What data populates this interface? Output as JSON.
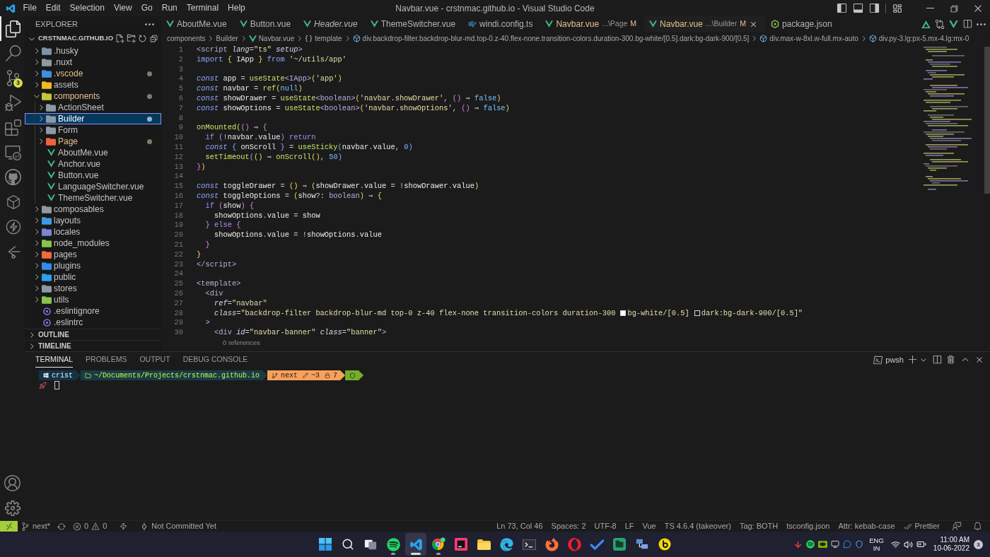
{
  "title_bar": {
    "menu": [
      "File",
      "Edit",
      "Selection",
      "View",
      "Go",
      "Run",
      "Terminal",
      "Help"
    ],
    "title": "Navbar.vue - crstnmac.github.io - Visual Studio Code"
  },
  "activity_bar": {
    "items": [
      {
        "kind": "explorer",
        "selected": true
      },
      {
        "kind": "search",
        "selected": false
      },
      {
        "kind": "source_control",
        "selected": false,
        "badge": "3"
      },
      {
        "kind": "run_debug",
        "selected": false
      },
      {
        "kind": "extensions",
        "selected": false
      },
      {
        "kind": "remote_explorer",
        "selected": false
      },
      {
        "kind": "github",
        "selected": false
      },
      {
        "kind": "cube",
        "selected": false
      },
      {
        "kind": "bolt",
        "selected": false
      },
      {
        "kind": "timeline",
        "selected": false
      }
    ],
    "bottom_items": [
      {
        "kind": "account"
      },
      {
        "kind": "settings"
      }
    ]
  },
  "sidebar": {
    "title": "EXPLORER",
    "workspace": {
      "name": "CRSTNMAC.GITHUB.IO",
      "expanded": true
    },
    "tree": [
      {
        "label": ".husky",
        "kind": "folder",
        "color": "#7d93a8",
        "expanded": false,
        "selected": false,
        "modified": false
      },
      {
        "label": ".nuxt",
        "kind": "folder",
        "color": "#8d9aa3",
        "expanded": false,
        "selected": false,
        "modified": false
      },
      {
        "label": ".vscode",
        "kind": "folder",
        "color": "#3f8fe0",
        "expanded": false,
        "selected": false,
        "modified": true
      },
      {
        "label": "assets",
        "kind": "folder",
        "color": "#f2b824",
        "expanded": false,
        "selected": false,
        "modified": false
      },
      {
        "label": "components",
        "kind": "folder",
        "color": "#c2c73a",
        "expanded": true,
        "selected": false,
        "modified": true,
        "children": [
          {
            "label": "ActionSheet",
            "kind": "folder",
            "color": "#8d9aa3",
            "expanded": false,
            "selected": false,
            "modified": false
          },
          {
            "label": "Builder",
            "kind": "folder",
            "color": "#8d9aa3",
            "expanded": false,
            "selected": true,
            "modified": true
          },
          {
            "label": "Form",
            "kind": "folder",
            "color": "#8d9aa3",
            "expanded": false,
            "selected": false,
            "modified": false
          },
          {
            "label": "Page",
            "kind": "folder",
            "color": "#f0623e",
            "expanded": false,
            "selected": false,
            "modified": true
          },
          {
            "label": "AboutMe.vue",
            "kind": "vue",
            "selected": false,
            "modified": false
          },
          {
            "label": "Anchor.vue",
            "kind": "vue",
            "selected": false,
            "modified": false
          },
          {
            "label": "Button.vue",
            "kind": "vue",
            "selected": false,
            "modified": false
          },
          {
            "label": "LanguageSwitcher.vue",
            "kind": "vue",
            "selected": false,
            "modified": false
          },
          {
            "label": "ThemeSwitcher.vue",
            "kind": "vue",
            "selected": false,
            "modified": false
          }
        ]
      },
      {
        "label": "composables",
        "kind": "folder",
        "color": "#8d9aa3",
        "expanded": false,
        "selected": false,
        "modified": false
      },
      {
        "label": "layouts",
        "kind": "folder",
        "color": "#3d9be9",
        "expanded": false,
        "selected": false,
        "modified": false
      },
      {
        "label": "locales",
        "kind": "folder",
        "color": "#7d83d6",
        "expanded": false,
        "selected": false,
        "modified": false
      },
      {
        "label": "node_modules",
        "kind": "folder",
        "color": "#8bc34a",
        "expanded": false,
        "selected": false,
        "modified": false
      },
      {
        "label": "pages",
        "kind": "folder",
        "color": "#f26b3a",
        "expanded": false,
        "selected": false,
        "modified": false
      },
      {
        "label": "plugins",
        "kind": "folder",
        "color": "#2f8fe8",
        "expanded": false,
        "selected": false,
        "modified": false
      },
      {
        "label": "public",
        "kind": "folder",
        "color": "#2f9ef0",
        "expanded": false,
        "selected": false,
        "modified": false
      },
      {
        "label": "stores",
        "kind": "folder",
        "color": "#8d9aa3",
        "expanded": false,
        "selected": false,
        "modified": false
      },
      {
        "label": "utils",
        "kind": "folder",
        "color": "#8bc34a",
        "expanded": false,
        "selected": false,
        "modified": false
      },
      {
        "label": ".eslintignore",
        "kind": "eslint",
        "selected": false,
        "modified": false
      },
      {
        "label": ".eslintrc",
        "kind": "eslint",
        "selected": false,
        "modified": false
      }
    ],
    "sections": [
      {
        "label": "OUTLINE",
        "expanded": false
      },
      {
        "label": "TIMELINE",
        "expanded": false
      }
    ]
  },
  "editor": {
    "tabs": [
      {
        "label": "AboutMe.vue",
        "kind": "vue",
        "selected": false,
        "preview": false
      },
      {
        "label": "Button.vue",
        "kind": "vue",
        "selected": false,
        "preview": false
      },
      {
        "label": "Header.vue",
        "kind": "vue",
        "selected": false,
        "preview": true
      },
      {
        "label": "ThemeSwitcher.vue",
        "kind": "vue",
        "selected": false,
        "preview": false
      },
      {
        "label": "windi.config.ts",
        "kind": "windi",
        "selected": false,
        "preview": false
      },
      {
        "label": "Navbar.vue",
        "kind": "vue",
        "description": "...\\Page",
        "status": "M",
        "selected": false,
        "preview": false
      },
      {
        "label": "Navbar.vue",
        "kind": "vue",
        "description": "...\\Builder",
        "status": "M",
        "selected": true,
        "preview": false
      },
      {
        "label": "package.json",
        "kind": "npm",
        "selected": false,
        "preview": false
      }
    ],
    "breadcrumbs": [
      {
        "label": "components",
        "kind": "folder"
      },
      {
        "label": "Builder",
        "kind": "folder"
      },
      {
        "label": "Navbar.vue",
        "kind": "vue"
      },
      {
        "label": "template",
        "kind": "braces"
      },
      {
        "label": "div.backdrop-filter.backdrop-blur-md.top-0.z-40.flex-none.transition-colors.duration-300.bg-white/[0.5].dark:bg-dark-900/[0.5]",
        "kind": "element"
      },
      {
        "label": "div.max-w-8xl.w-full.mx-auto",
        "kind": "element"
      },
      {
        "label": "div.py-3.lg:px-5.mx-4.lg:mx-0",
        "kind": "element"
      }
    ],
    "code": [
      {
        "number": "1",
        "tokens": [
          {
            "kind": "tag",
            "text": "<script"
          },
          {
            "kind": "attribute",
            "text": " lang"
          },
          {
            "kind": "operator",
            "text": "="
          },
          {
            "kind": "string",
            "text": "\"ts\""
          },
          {
            "kind": "attribute",
            "text": " setup"
          },
          {
            "kind": "tag",
            "text": ">"
          }
        ]
      },
      {
        "number": "2",
        "tokens": [
          {
            "kind": "keyword",
            "text": "import"
          },
          {
            "kind": "bracket1",
            "text": " {"
          },
          {
            "kind": "variable",
            "text": " IApp"
          },
          {
            "kind": "bracket1",
            "text": " }"
          },
          {
            "kind": "keyword",
            "text": " from"
          },
          {
            "kind": "string",
            "text": " '~/utils/app'"
          }
        ]
      },
      {
        "number": "3"
      },
      {
        "number": "4",
        "tokens": [
          {
            "kind": "storage",
            "text": "const"
          },
          {
            "kind": "variable",
            "text": " app"
          },
          {
            "kind": "operator",
            "text": " ="
          },
          {
            "kind": "function",
            "text": " useState"
          },
          {
            "kind": "type",
            "text": "<IApp>"
          },
          {
            "kind": "bracket1",
            "text": "("
          },
          {
            "kind": "string",
            "text": "'app'"
          },
          {
            "kind": "bracket1",
            "text": ")"
          }
        ]
      },
      {
        "number": "5",
        "tokens": [
          {
            "kind": "storage",
            "text": "const"
          },
          {
            "kind": "variable",
            "text": " navbar"
          },
          {
            "kind": "operator",
            "text": " ="
          },
          {
            "kind": "function",
            "text": " ref"
          },
          {
            "kind": "bracket1",
            "text": "("
          },
          {
            "kind": "constant",
            "text": "null"
          },
          {
            "kind": "bracket1",
            "text": ")"
          }
        ]
      },
      {
        "number": "6",
        "tokens": [
          {
            "kind": "storage",
            "text": "const"
          },
          {
            "kind": "variable",
            "text": " showDrawer"
          },
          {
            "kind": "operator",
            "text": " ="
          },
          {
            "kind": "function",
            "text": " useState"
          },
          {
            "kind": "type",
            "text": "<boolean>"
          },
          {
            "kind": "bracket1",
            "text": "("
          },
          {
            "kind": "string",
            "text": "'navbar.showDrawer'"
          },
          {
            "kind": "operator",
            "text": ","
          },
          {
            "kind": "bracket2",
            "text": " ()"
          },
          {
            "kind": "operator",
            "text": " ⇒"
          },
          {
            "kind": "constant",
            "text": " false"
          },
          {
            "kind": "bracket1",
            "text": ")"
          }
        ]
      },
      {
        "number": "7",
        "tokens": [
          {
            "kind": "storage",
            "text": "const"
          },
          {
            "kind": "variable",
            "text": " showOptions"
          },
          {
            "kind": "operator",
            "text": " ="
          },
          {
            "kind": "function",
            "text": " useState"
          },
          {
            "kind": "type",
            "text": "<boolean>"
          },
          {
            "kind": "bracket1",
            "text": "("
          },
          {
            "kind": "string",
            "text": "'navbar.showOptions'"
          },
          {
            "kind": "operator",
            "text": ","
          },
          {
            "kind": "bracket2",
            "text": " ()"
          },
          {
            "kind": "operator",
            "text": " ⇒"
          },
          {
            "kind": "constant",
            "text": " false"
          },
          {
            "kind": "bracket1",
            "text": ")"
          }
        ]
      },
      {
        "number": "8"
      },
      {
        "number": "9",
        "tokens": [
          {
            "kind": "function",
            "text": "onMounted"
          },
          {
            "kind": "bracket1",
            "text": "("
          },
          {
            "kind": "bracket2",
            "text": "()"
          },
          {
            "kind": "operator",
            "text": " ⇒"
          },
          {
            "kind": "bracket2",
            "text": " {"
          }
        ]
      },
      {
        "number": "10",
        "tokens": [
          {
            "kind": "control",
            "text": "  if"
          },
          {
            "kind": "bracket3",
            "text": " ("
          },
          {
            "kind": "operator",
            "text": "!"
          },
          {
            "kind": "variable",
            "text": "navbar"
          },
          {
            "kind": "operator",
            "text": "."
          },
          {
            "kind": "variable",
            "text": "value"
          },
          {
            "kind": "bracket3",
            "text": ")"
          },
          {
            "kind": "control",
            "text": " return"
          }
        ]
      },
      {
        "number": "11",
        "tokens": [
          {
            "kind": "storage",
            "text": "  const"
          },
          {
            "kind": "bracket3",
            "text": " {"
          },
          {
            "kind": "variable",
            "text": " onScroll"
          },
          {
            "kind": "bracket3",
            "text": " }"
          },
          {
            "kind": "operator",
            "text": " ="
          },
          {
            "kind": "function",
            "text": " useSticky"
          },
          {
            "kind": "bracket3",
            "text": "("
          },
          {
            "kind": "variable",
            "text": "navbar"
          },
          {
            "kind": "operator",
            "text": "."
          },
          {
            "kind": "variable",
            "text": "value"
          },
          {
            "kind": "operator",
            "text": ","
          },
          {
            "kind": "constant",
            "text": " 0"
          },
          {
            "kind": "bracket3",
            "text": ")"
          }
        ]
      },
      {
        "number": "12",
        "tokens": [
          {
            "kind": "function",
            "text": "  setTimeout"
          },
          {
            "kind": "bracket3",
            "text": "("
          },
          {
            "kind": "bracket1",
            "text": "()"
          },
          {
            "kind": "operator",
            "text": " ⇒"
          },
          {
            "kind": "function",
            "text": " onScroll"
          },
          {
            "kind": "bracket1",
            "text": "()"
          },
          {
            "kind": "operator",
            "text": ","
          },
          {
            "kind": "constant",
            "text": " 50"
          },
          {
            "kind": "bracket3",
            "text": ")"
          }
        ]
      },
      {
        "number": "13",
        "tokens": [
          {
            "kind": "bracket2",
            "text": "}"
          },
          {
            "kind": "bracket1",
            "text": ")"
          }
        ]
      },
      {
        "number": "14"
      },
      {
        "number": "15",
        "tokens": [
          {
            "kind": "storage",
            "text": "const"
          },
          {
            "kind": "variable",
            "text": " toggleDrawer"
          },
          {
            "kind": "operator",
            "text": " ="
          },
          {
            "kind": "bracket1",
            "text": " ()"
          },
          {
            "kind": "operator",
            "text": " ⇒"
          },
          {
            "kind": "bracket1",
            "text": " ("
          },
          {
            "kind": "variable",
            "text": "showDrawer"
          },
          {
            "kind": "operator",
            "text": "."
          },
          {
            "kind": "variable",
            "text": "value"
          },
          {
            "kind": "operator",
            "text": " = !"
          },
          {
            "kind": "variable",
            "text": "showDrawer"
          },
          {
            "kind": "operator",
            "text": "."
          },
          {
            "kind": "variable",
            "text": "value"
          },
          {
            "kind": "bracket1",
            "text": ")"
          }
        ]
      },
      {
        "number": "16",
        "tokens": [
          {
            "kind": "storage",
            "text": "const"
          },
          {
            "kind": "variable",
            "text": " toggleOptions"
          },
          {
            "kind": "operator",
            "text": " ="
          },
          {
            "kind": "bracket1",
            "text": " ("
          },
          {
            "kind": "variable",
            "text": "show"
          },
          {
            "kind": "operator",
            "text": "?:"
          },
          {
            "kind": "type",
            "text": " boolean"
          },
          {
            "kind": "bracket1",
            "text": ")"
          },
          {
            "kind": "operator",
            "text": " ⇒"
          },
          {
            "kind": "bracket1",
            "text": " {"
          }
        ]
      },
      {
        "number": "17",
        "tokens": [
          {
            "kind": "control",
            "text": "  if"
          },
          {
            "kind": "bracket2",
            "text": " ("
          },
          {
            "kind": "variable",
            "text": "show"
          },
          {
            "kind": "bracket2",
            "text": ")"
          },
          {
            "kind": "bracket2",
            "text": " {"
          }
        ]
      },
      {
        "number": "18",
        "tokens": [
          {
            "kind": "variable",
            "text": "    showOptions"
          },
          {
            "kind": "operator",
            "text": "."
          },
          {
            "kind": "variable",
            "text": "value"
          },
          {
            "kind": "operator",
            "text": " ="
          },
          {
            "kind": "variable",
            "text": " show"
          }
        ]
      },
      {
        "number": "19",
        "tokens": [
          {
            "kind": "bracket2",
            "text": "  }"
          },
          {
            "kind": "control",
            "text": " else"
          },
          {
            "kind": "bracket2",
            "text": " {"
          }
        ]
      },
      {
        "number": "20",
        "tokens": [
          {
            "kind": "variable",
            "text": "    showOptions"
          },
          {
            "kind": "operator",
            "text": "."
          },
          {
            "kind": "variable",
            "text": "value"
          },
          {
            "kind": "operator",
            "text": " = !"
          },
          {
            "kind": "variable",
            "text": "showOptions"
          },
          {
            "kind": "operator",
            "text": "."
          },
          {
            "kind": "variable",
            "text": "value"
          }
        ]
      },
      {
        "number": "21",
        "tokens": [
          {
            "kind": "bracket2",
            "text": "  }"
          }
        ]
      },
      {
        "number": "22",
        "tokens": [
          {
            "kind": "bracket1",
            "text": "}"
          }
        ]
      },
      {
        "number": "23",
        "tokens": [
          {
            "kind": "tag",
            "text": "</script>"
          }
        ]
      },
      {
        "number": "24"
      },
      {
        "number": "25",
        "tokens": [
          {
            "kind": "tag",
            "text": "<template>"
          }
        ]
      },
      {
        "number": "26",
        "tokens": [
          {
            "kind": "tag",
            "text": "  <div"
          }
        ]
      },
      {
        "number": "27",
        "tokens": [
          {
            "kind": "attribute",
            "text": "    ref"
          },
          {
            "kind": "operator",
            "text": "="
          },
          {
            "kind": "string",
            "text": "\"navbar\""
          }
        ]
      },
      {
        "number": "28",
        "tokens": [
          {
            "kind": "attribute",
            "text": "    class"
          },
          {
            "kind": "operator",
            "text": "="
          },
          {
            "kind": "string",
            "text": "\"backdrop-filter backdrop-blur-md top-0 z-40 flex-none transition-colors duration-300"
          },
          {
            "kind": "swatch",
            "color": "#ffffff"
          },
          {
            "kind": "string",
            "text": "bg-white/[0.5]"
          },
          {
            "kind": "swatch",
            "color": "#1b1b1b"
          },
          {
            "kind": "string",
            "text": "dark:bg-dark-900/[0.5]\""
          }
        ]
      },
      {
        "number": "29",
        "tokens": [
          {
            "kind": "tag",
            "text": "  >"
          }
        ]
      },
      {
        "number": "30",
        "tokens": [
          {
            "kind": "tag",
            "text": "    <div"
          },
          {
            "kind": "attribute",
            "text": " id"
          },
          {
            "kind": "operator",
            "text": "="
          },
          {
            "kind": "string",
            "text": "\"navbar-banner\""
          },
          {
            "kind": "attribute",
            "text": " class"
          },
          {
            "kind": "operator",
            "text": "="
          },
          {
            "kind": "string",
            "text": "\"banner\""
          },
          {
            "kind": "tag",
            "text": ">"
          }
        ],
        "codelens": "0 references"
      }
    ]
  },
  "panel": {
    "tabs": [
      {
        "label": "TERMINAL",
        "selected": true
      },
      {
        "label": "PROBLEMS",
        "selected": false
      },
      {
        "label": "OUTPUT",
        "selected": false
      },
      {
        "label": "DEBUG CONSOLE",
        "selected": false
      }
    ],
    "shell": "pwsh",
    "terminal": {
      "prompt": [
        {
          "kind": "user",
          "color": "#143247",
          "text": "crist"
        },
        {
          "kind": "path",
          "color": "#183c45",
          "text": "~/Documents/Projects/crstnmac.github.io"
        },
        {
          "kind": "git",
          "color": "#f7a15c",
          "parts": [
            {
              "kind": "branch",
              "text": "next"
            },
            {
              "kind": "changes",
              "text": "~3"
            },
            {
              "kind": "stash",
              "text": "7"
            }
          ]
        },
        {
          "kind": "status",
          "color": "#76ad2b"
        }
      ]
    }
  },
  "status_bar": {
    "left": [
      {
        "kind": "remote"
      },
      {
        "kind": "branch",
        "text": "next*"
      },
      {
        "kind": "sync"
      },
      {
        "kind": "problems",
        "errors": "0",
        "warnings": "0"
      },
      {
        "kind": "plug"
      },
      {
        "kind": "commit",
        "text": "Not Committed Yet"
      }
    ],
    "right": [
      {
        "kind": "text",
        "text": "Ln 73, Col 46"
      },
      {
        "kind": "text",
        "text": "Spaces: 2"
      },
      {
        "kind": "text",
        "text": "UTF-8"
      },
      {
        "kind": "text",
        "text": "LF"
      },
      {
        "kind": "text",
        "text": "Vue"
      },
      {
        "kind": "text",
        "text": "TS 4.6.4 (takeover)"
      },
      {
        "kind": "text",
        "text": "Tag: BOTH"
      },
      {
        "kind": "text",
        "text": "tsconfig.json"
      },
      {
        "kind": "text",
        "text": "Attr: kebab-case"
      },
      {
        "kind": "prettier",
        "text": "Prettier"
      },
      {
        "kind": "feedback"
      },
      {
        "kind": "notifications"
      }
    ]
  },
  "taskbar": {
    "apps": [
      {
        "kind": "start",
        "running": false,
        "active": false
      },
      {
        "kind": "search",
        "running": false,
        "active": false
      },
      {
        "kind": "task_view",
        "running": false,
        "active": false
      },
      {
        "kind": "spotify",
        "running": true,
        "active": false
      },
      {
        "kind": "vscode",
        "running": true,
        "active": true
      },
      {
        "kind": "chrome",
        "running": true,
        "active": false
      },
      {
        "kind": "jetbrains",
        "running": false,
        "active": false
      },
      {
        "kind": "files",
        "running": false,
        "active": false
      },
      {
        "kind": "edge",
        "running": false,
        "active": false
      },
      {
        "kind": "terminal",
        "running": false,
        "active": false
      },
      {
        "kind": "firefox",
        "running": false,
        "active": false
      },
      {
        "kind": "opera",
        "running": false,
        "active": false
      },
      {
        "kind": "todo",
        "running": false,
        "active": false
      },
      {
        "kind": "green_app",
        "running": false,
        "active": false
      },
      {
        "kind": "network_app",
        "running": false,
        "active": false
      },
      {
        "kind": "yellow_app",
        "running": false,
        "active": false
      }
    ],
    "language": [
      "ENG",
      "IN"
    ],
    "clock": {
      "time": "11:00 AM",
      "date": "10-06-2022"
    },
    "notifications": "3"
  }
}
